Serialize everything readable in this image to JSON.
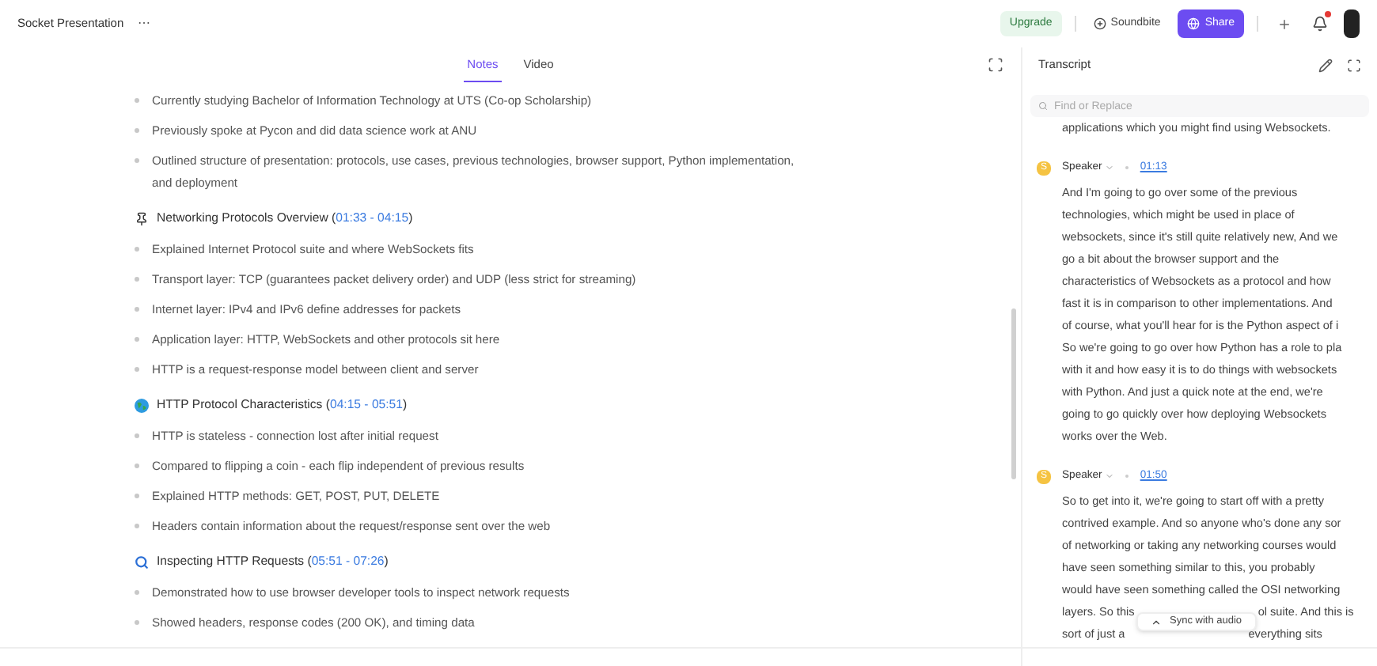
{
  "header": {
    "title": "Socket Presentation",
    "menu": "⋯",
    "upgrade": "Upgrade",
    "soundbite": "Soundbite",
    "share": "Share",
    "notification_dot": true
  },
  "notes_tabs": [
    {
      "label": "Notes",
      "selected": true
    },
    {
      "label": "Video",
      "selected": false
    }
  ],
  "intro_bullets": [
    "Currently studying Bachelor of Information Technology at UTS (Co-op Scholarship)",
    "Previously spoke at Pycon and did data science work at ANU",
    "Outlined structure of presentation: protocols, use cases, previous technologies, browser support, Python implementation, and deployment"
  ],
  "sections": [
    {
      "title": "Networking Protocols Overview",
      "paren_open": "(",
      "time": "01:33 - 04:15",
      "paren_close": ")",
      "bullets": [
        "Explained Internet Protocol suite and where WebSockets fits",
        "Transport layer: TCP (guarantees packet delivery order) and UDP (less strict for streaming)",
        "Internet layer: IPv4 and IPv6 define addresses for packets",
        "Application layer: HTTP, WebSockets and other protocols sit here",
        "HTTP is a request-response model between client and server"
      ]
    },
    {
      "title": "HTTP Protocol Characteristics",
      "paren_open": "(",
      "time": "04:15 - 05:51",
      "paren_close": ")",
      "bullets": [
        "HTTP is stateless - connection lost after initial request",
        "Compared to flipping a coin - each flip independent of previous results",
        "Explained HTTP methods: GET, POST, PUT, DELETE",
        "Headers contain information about the request/response sent over the web"
      ]
    },
    {
      "title": "Inspecting HTTP Requests",
      "paren_open": "(",
      "time": "05:51 - 07:26",
      "paren_close": ")",
      "bullets": [
        "Demonstrated how to use browser developer tools to inspect network requests",
        "Showed headers, response codes (200 OK), and timing data"
      ]
    }
  ],
  "transcript": {
    "title": "Transcript",
    "search": {
      "placeholder": "Find or Replace"
    },
    "lead_line": "applications which you might find using Websockets.",
    "segments": [
      {
        "avatar": "S",
        "speaker": "Speaker",
        "time": "01:13",
        "lines": [
          "And I'm going to go over some of the previous",
          "technologies, which might be used in place of",
          "websockets, since it's still quite relatively new, And we",
          "go a bit about the browser support and the",
          "characteristics of Websockets as a protocol and how",
          "fast it is in comparison to other implementations. And",
          "of course, what you'll hear for is the Python aspect of i",
          "So we're going to go over how Python has a role to pla",
          "with it and how easy it is to do things with websockets",
          "with Python. And just a quick note at the end, we're",
          "going to go quickly over how deploying Websockets",
          "works over the Web."
        ]
      },
      {
        "avatar": "S",
        "speaker": "Speaker",
        "time": "01:50",
        "lines": [
          "So to get into it, we're going to start off with a pretty",
          "contrived example. And so anyone who's done any sor",
          "of networking or taking any networking courses would",
          "have seen something similar to this, you probably",
          "would have seen something called the OSI networking",
          {
            "parts": [
              "layers. So this",
              "ol suite. And this is"
            ]
          },
          {
            "parts": [
              "sort of just a",
              "everything sits"
            ]
          }
        ]
      }
    ],
    "sync_button": "Sync with audio"
  }
}
